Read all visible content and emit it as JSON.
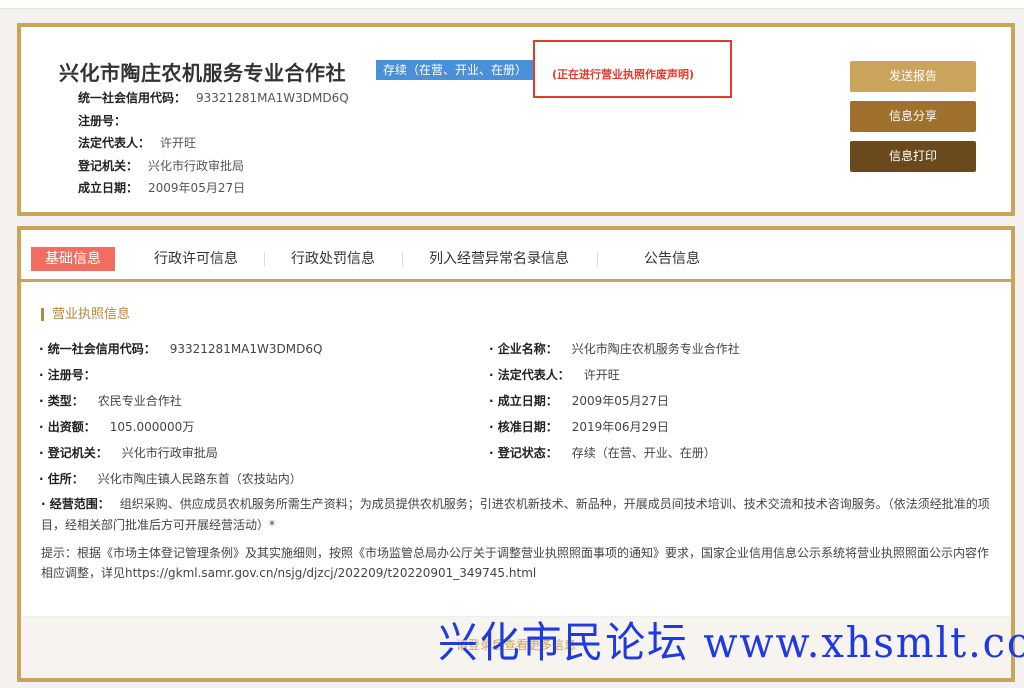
{
  "company": {
    "name": "兴化市陶庄农机服务专业合作社",
    "status_tag": "存续（在营、开业、在册）",
    "notice": "(正在进行营业执照作废声明)"
  },
  "header_fields": [
    {
      "label": "统一社会信用代码：",
      "value": "93321281MA1W3DMD6Q"
    },
    {
      "label": "注册号：",
      "value": ""
    },
    {
      "label": "法定代表人：",
      "value": "许开旺"
    },
    {
      "label": "登记机关：",
      "value": "兴化市行政审批局"
    },
    {
      "label": "成立日期：",
      "value": "2009年05月27日"
    }
  ],
  "buttons": {
    "report": "发送报告",
    "share": "信息分享",
    "print": "信息打印"
  },
  "tabs": [
    "基础信息",
    "行政许可信息",
    "行政处罚信息",
    "列入经营异常名录信息",
    "公告信息"
  ],
  "active_tab": 0,
  "section_title": "营业执照信息",
  "left_fields": [
    {
      "label": "· 统一社会信用代码：",
      "value": "93321281MA1W3DMD6Q"
    },
    {
      "label": "· 注册号：",
      "value": ""
    },
    {
      "label": "· 类型：",
      "value": "农民专业合作社"
    },
    {
      "label": "· 出资额：",
      "value": "105.000000万"
    },
    {
      "label": "· 登记机关：",
      "value": "兴化市行政审批局"
    },
    {
      "label": "· 住所：",
      "value": "兴化市陶庄镇人民路东首（农技站内）"
    }
  ],
  "right_fields": [
    {
      "label": "· 企业名称：",
      "value": "兴化市陶庄农机服务专业合作社"
    },
    {
      "label": "· 法定代表人：",
      "value": "许开旺"
    },
    {
      "label": "· 成立日期：",
      "value": "2009年05月27日"
    },
    {
      "label": "· 核准日期：",
      "value": "2019年06月29日"
    },
    {
      "label": "· 登记状态：",
      "value": "存续（在营、开业、在册）"
    }
  ],
  "scope": {
    "label": "· 经营范围：",
    "value": "组织采购、供应成员农机服务所需生产资料；为成员提供农机服务；引进农机新技术、新品种，开展成员间技术培训、技术交流和技术咨询服务。（依法须经批准的项目，经相关部门批准后方可开展经营活动）*"
  },
  "tip": "提示：根据《市场主体登记管理条例》及其实施细则，按照《市场监管总局办公厅关于调整营业执照照面事项的通知》要求，国家企业信用信息公示系统将营业执照照面公示内容作相应调整，详见https://gkml.samr.gov.cn/nsjg/djzcj/202209/t20220901_349745.html",
  "more_link": "请登录后查看更多信息",
  "watermark": "兴化市民论坛 www.xhsmlt.com"
}
